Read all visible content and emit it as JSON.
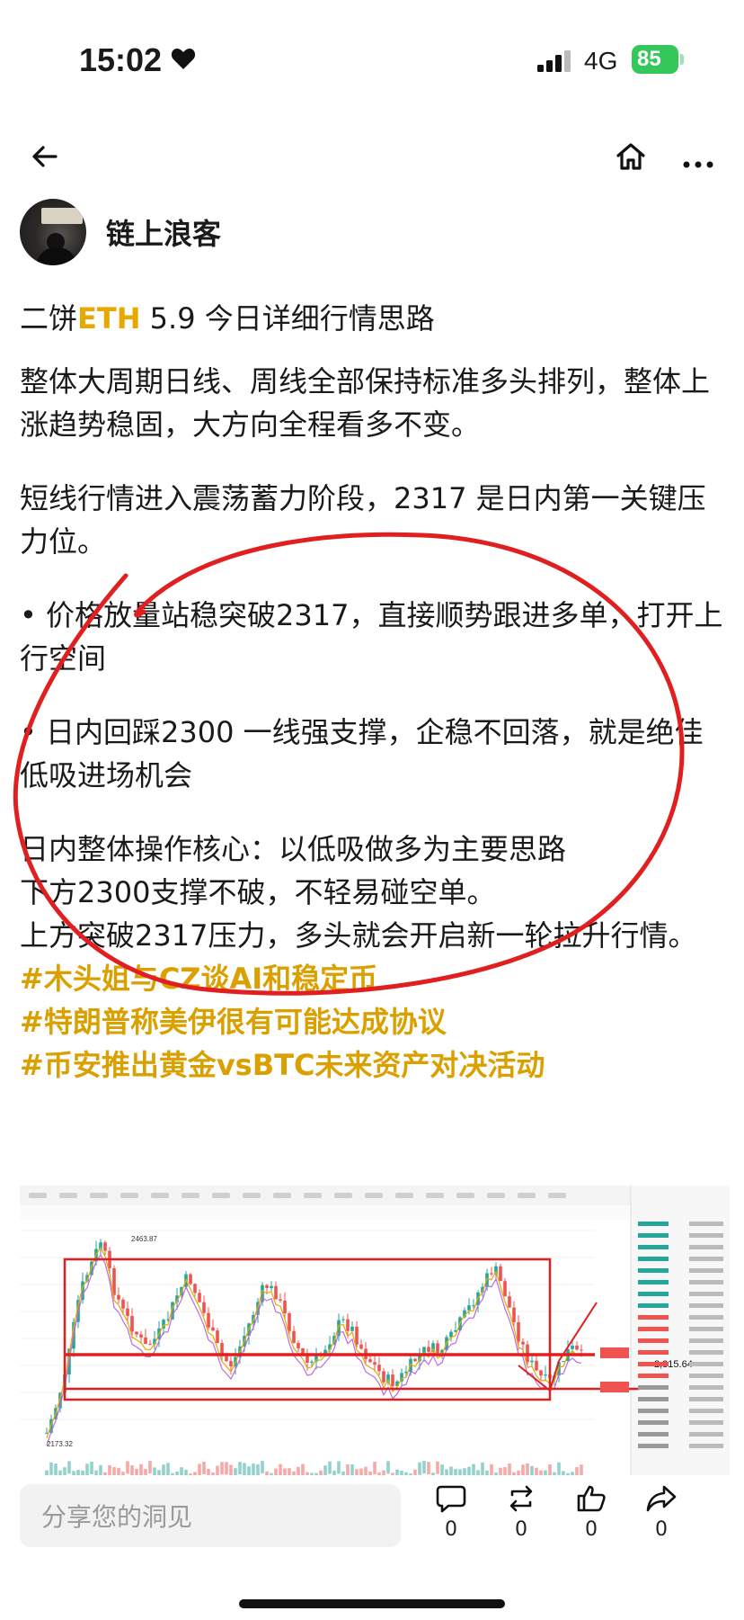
{
  "status_bar": {
    "time": "15:02",
    "network": "4G",
    "battery": "85"
  },
  "author": {
    "name": "链上浪客"
  },
  "post": {
    "title_prefix": "二饼",
    "title_eth": "ETH",
    "title_suffix": " 5.9 今日详细行情思路",
    "para1": "整体大周期日线、周线全部保持标准多头排列，整体上涨趋势稳固，大方向全程看多不变。",
    "para2": "短线行情进入震荡蓄力阶段，2317 是日内第一关键压力位。",
    "bullet1": "• 价格放量站稳突破2317，直接顺势跟进多单，打开上行空间",
    "bullet2": "• 日内回踩2300 一线强支撑，企稳不回落，就是绝佳低吸进场机会",
    "core1": "日内整体操作核心：以低吸做多为主要思路",
    "core2": "下方2300支撑不破，不轻易碰空单。",
    "core3": "上方突破2317压力，多头就会开启新一轮拉升行情。",
    "tag1": "#木头姐与CZ谈AI和稳定币",
    "tag2": "#特朗普称美伊很有可能达成协议",
    "tag3": "#币安推出黄金vsBTC未来资产对决活动"
  },
  "chart_image": {
    "price_label": "2,315.64",
    "high_label": "2463.87",
    "low_label": "2173.32"
  },
  "bottom_bar": {
    "input_placeholder": "分享您的洞见",
    "comment_count": "0",
    "repost_count": "0",
    "like_count": "0",
    "share_count": "0"
  },
  "colors": {
    "accent_gold": "#e8a800",
    "up": "#26a69a",
    "down": "#ef5350",
    "annotation_red": "#e02020"
  }
}
